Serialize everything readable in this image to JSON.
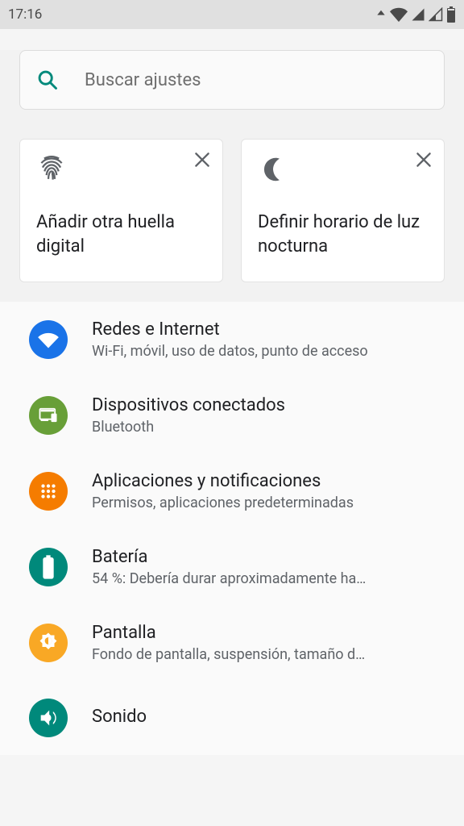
{
  "status": {
    "time": "17:16"
  },
  "search": {
    "placeholder": "Buscar ajustes"
  },
  "cards": [
    {
      "title": "Añadir otra huella digital"
    },
    {
      "title": "Definir horario de luz nocturna"
    }
  ],
  "settings": [
    {
      "title": "Redes e Internet",
      "sub": "Wi-Fi, móvil, uso de datos, punto de acceso",
      "bg": "#1a73e8",
      "icon": "wifi"
    },
    {
      "title": "Dispositivos conectados",
      "sub": "Bluetooth",
      "bg": "#689f38",
      "icon": "devices"
    },
    {
      "title": "Aplicaciones y notificaciones",
      "sub": "Permisos, aplicaciones predeterminadas",
      "bg": "#f57c00",
      "icon": "apps"
    },
    {
      "title": "Batería",
      "sub": "54 %: Debería durar aproximadamente ha…",
      "bg": "#00897b",
      "icon": "battery"
    },
    {
      "title": "Pantalla",
      "sub": "Fondo de pantalla, suspensión, tamaño d…",
      "bg": "#f9a825",
      "icon": "brightness"
    },
    {
      "title": "Sonido",
      "sub": "",
      "bg": "#00897b",
      "icon": "sound"
    }
  ]
}
